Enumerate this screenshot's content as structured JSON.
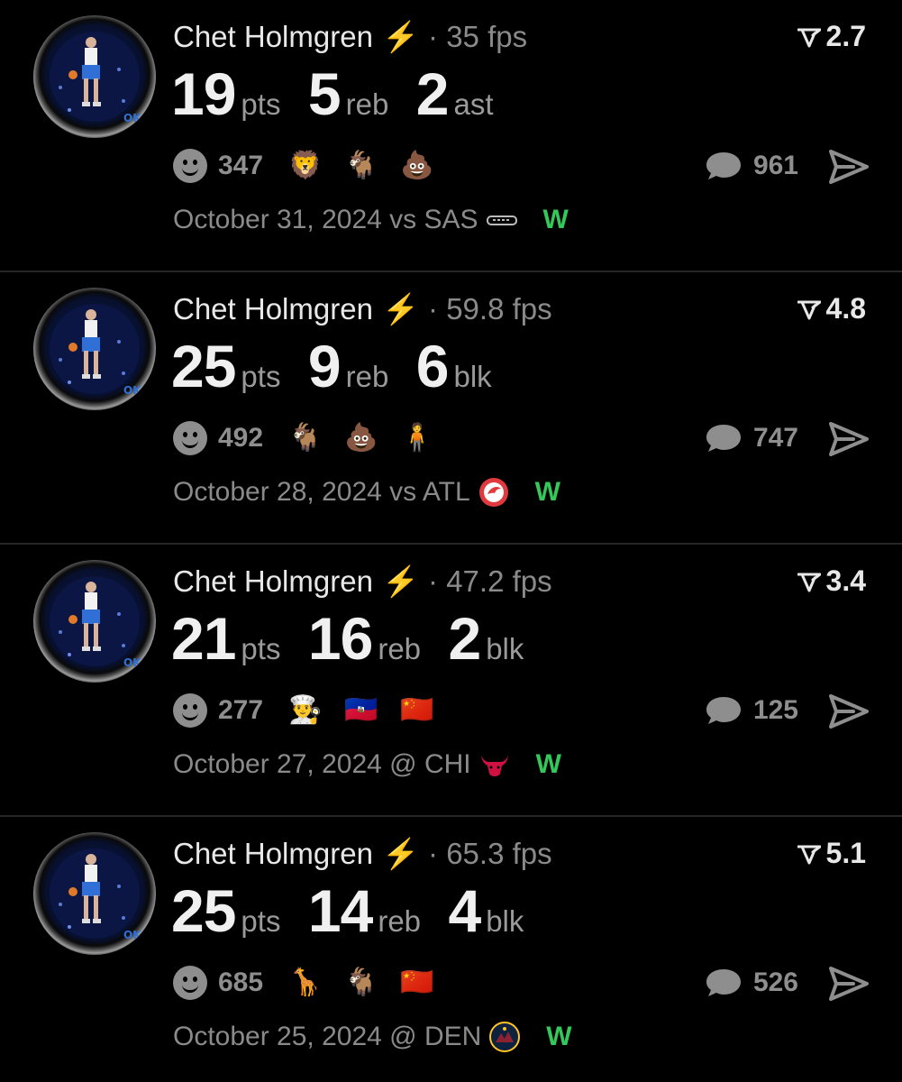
{
  "posts": [
    {
      "player": "Chet Holmgren",
      "fps": "35 fps",
      "rating": "2.7",
      "stats": [
        {
          "value": "19",
          "unit": "pts"
        },
        {
          "value": "5",
          "unit": "reb"
        },
        {
          "value": "2",
          "unit": "ast"
        }
      ],
      "reaction_count": "347",
      "emojis": [
        "🦁",
        "🐐",
        "💩"
      ],
      "comment_count": "961",
      "date_opponent": "October 31, 2024 vs SAS",
      "opponent_logo": "spurs-logo",
      "result": "W"
    },
    {
      "player": "Chet Holmgren",
      "fps": "59.8 fps",
      "rating": "4.8",
      "stats": [
        {
          "value": "25",
          "unit": "pts"
        },
        {
          "value": "9",
          "unit": "reb"
        },
        {
          "value": "6",
          "unit": "blk"
        }
      ],
      "reaction_count": "492",
      "emojis": [
        "🐐",
        "💩",
        "🧍"
      ],
      "comment_count": "747",
      "date_opponent": "October 28, 2024 vs ATL",
      "opponent_logo": "hawks-logo",
      "result": "W"
    },
    {
      "player": "Chet Holmgren",
      "fps": "47.2 fps",
      "rating": "3.4",
      "stats": [
        {
          "value": "21",
          "unit": "pts"
        },
        {
          "value": "16",
          "unit": "reb"
        },
        {
          "value": "2",
          "unit": "blk"
        }
      ],
      "reaction_count": "277",
      "emojis": [
        "👨‍🍳",
        "🇭🇹",
        "🇨🇳"
      ],
      "comment_count": "125",
      "date_opponent": "October 27, 2024 @ CHI",
      "opponent_logo": "bulls-logo",
      "result": "W"
    },
    {
      "player": "Chet Holmgren",
      "fps": "65.3 fps",
      "rating": "5.1",
      "stats": [
        {
          "value": "25",
          "unit": "pts"
        },
        {
          "value": "14",
          "unit": "reb"
        },
        {
          "value": "4",
          "unit": "blk"
        }
      ],
      "reaction_count": "685",
      "emojis": [
        "🦒",
        "🐐",
        "🇨🇳"
      ],
      "comment_count": "526",
      "date_opponent": "October 25, 2024 @ DEN",
      "opponent_logo": "nuggets-logo",
      "result": "W"
    }
  ],
  "colors": {
    "background": "#000000",
    "text_primary": "#e8e8e8",
    "text_secondary": "#8a8a8a",
    "win": "#34c759",
    "divider": "#262626"
  }
}
